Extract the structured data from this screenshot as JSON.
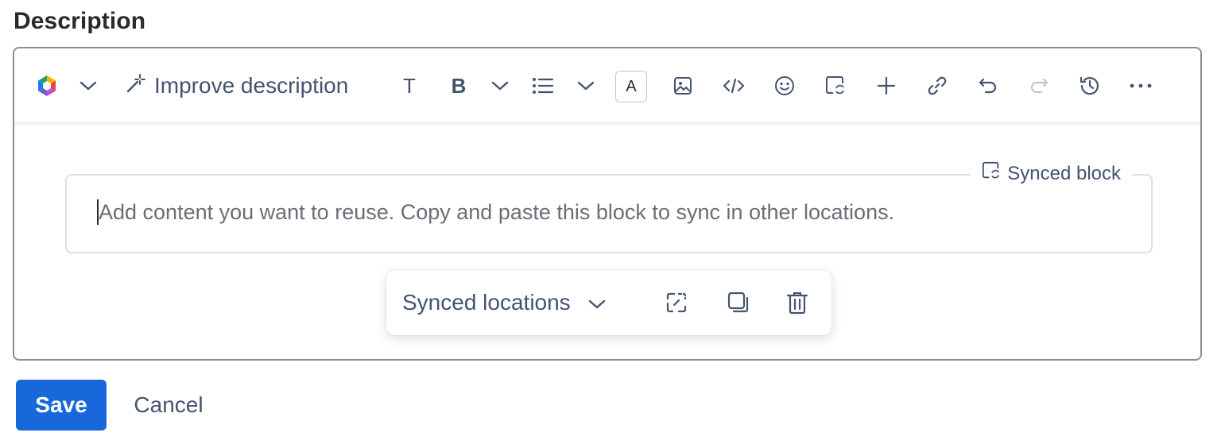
{
  "section": {
    "title": "Description"
  },
  "toolbar": {
    "improve_label": "Improve description",
    "items": [
      "ai-logo-icon",
      "chevron-down-icon",
      "magic-wand-icon",
      "text-style-icon",
      "bold-icon",
      "chevron-down-icon",
      "bullet-list-icon",
      "chevron-down-icon",
      "text-color-icon",
      "image-icon",
      "code-icon",
      "emoji-icon",
      "synced-block-icon",
      "plus-icon",
      "link-icon",
      "undo-icon",
      "redo-icon",
      "history-icon",
      "more-icon"
    ],
    "bold_glyph": "B",
    "text_glyph": "T",
    "text_color_glyph": "A"
  },
  "synced_block": {
    "label": "Synced block",
    "placeholder": "Add content you want to reuse. Copy and paste this block to sync in other locations."
  },
  "floating_toolbar": {
    "locations_label": "Synced locations",
    "icons": [
      "unsync-icon",
      "copy-icon",
      "delete-icon"
    ]
  },
  "actions": {
    "save_label": "Save",
    "cancel_label": "Cancel"
  },
  "colors": {
    "primary": "#1868db",
    "text": "#292a2e",
    "subtle": "#44546f",
    "border": "#8c8f97"
  }
}
